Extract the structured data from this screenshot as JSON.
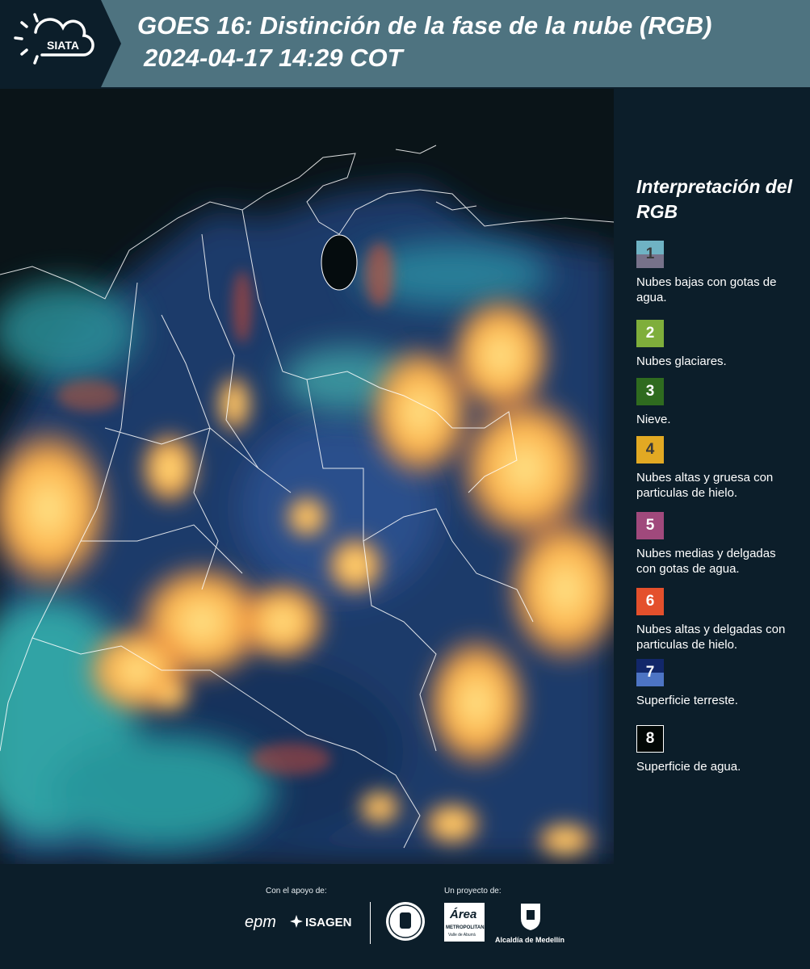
{
  "header": {
    "logo_text": "SIATA",
    "title_line1": "GOES 16: Distinción de la fase de la nube (RGB)",
    "title_line2": "2024-04-17 14:29 COT"
  },
  "legend": {
    "title": "Interpretación del RGB",
    "items": [
      {
        "number": "1",
        "label": "Nubes bajas con gotas de agua.",
        "color_top": "#6fb3c4",
        "color_bottom": "#77728a"
      },
      {
        "number": "2",
        "label": "Nubes glaciares.",
        "color_top": "#7fae3b",
        "color_bottom": "#7fae3b"
      },
      {
        "number": "3",
        "label": "Nieve.",
        "color_top": "#2f6b1f",
        "color_bottom": "#2f6b1f"
      },
      {
        "number": "4",
        "label": "Nubes altas y gruesa con particulas de hielo.",
        "color_top": "#e2a923",
        "color_bottom": "#e2a923"
      },
      {
        "number": "5",
        "label": "Nubes medias y delgadas con gotas de agua.",
        "color_top": "#a0497c",
        "color_bottom": "#a0497c"
      },
      {
        "number": "6",
        "label": "Nubes altas y delgadas con particulas de hielo.",
        "color_top": "#e4502c",
        "color_bottom": "#e4502c"
      },
      {
        "number": "7",
        "label": "Superficie terreste.",
        "color_top": "#12276a",
        "color_bottom": "#4d74c4"
      },
      {
        "number": "8",
        "label": "Superficie de agua.",
        "color_top": "#020806",
        "color_bottom": "#020806"
      }
    ]
  },
  "footer": {
    "support_caption": "Con el apoyo de:",
    "project_caption": "Un proyecto de:",
    "epm": "epm",
    "isagen": "ISAGEN",
    "area_metropolitana": "Área",
    "area_sub": "METROPOLITANA",
    "area_sub2": "Valle de Aburrá",
    "alcaldia": "Alcaldía de Medellín"
  }
}
